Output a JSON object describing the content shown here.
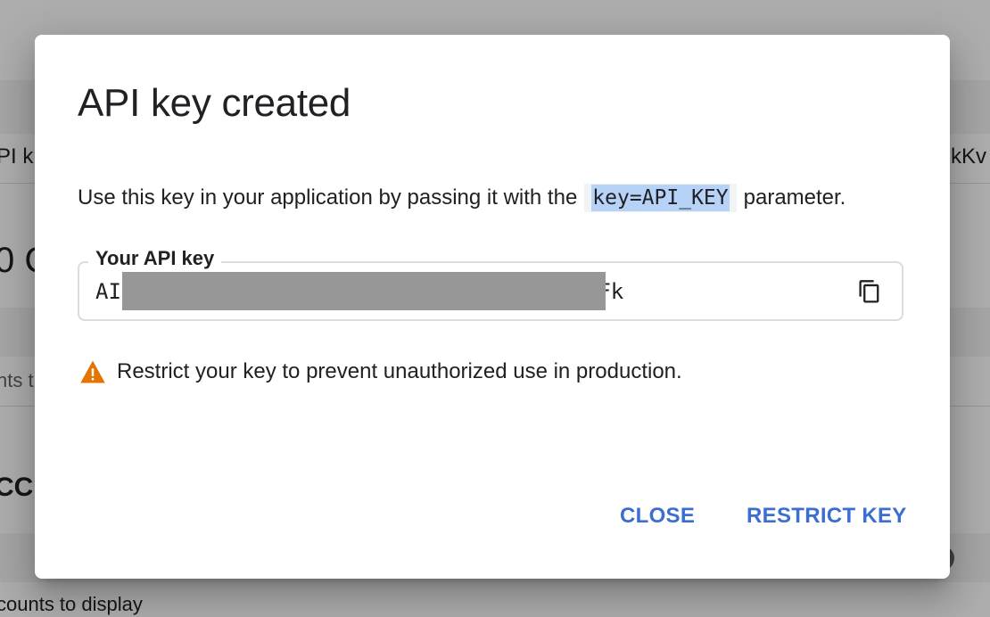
{
  "background": {
    "fragment_api_key": "PI k",
    "fragment_key_tail": "kKv",
    "fragment_big": "0 C",
    "fragment_accounts": "nts t",
    "fragment_heading": "CC",
    "fragment_no_accounts": "counts to display"
  },
  "dialog": {
    "title": "API key created",
    "description_before": "Use this key in your application by passing it with the",
    "description_code": "key=API_KEY",
    "description_after": "parameter.",
    "key_field": {
      "label": "Your API key",
      "value_prefix": "AI",
      "value_suffix": "SFk",
      "copy_icon": "copy-icon"
    },
    "warning": {
      "icon": "warning-icon",
      "text": "Restrict your key to prevent unauthorized use in production."
    },
    "actions": {
      "close_label": "CLOSE",
      "restrict_label": "RESTRICT KEY"
    }
  },
  "colors": {
    "accent": "#3c6dd1",
    "warning": "#e37400",
    "code_highlight": "#b6d2f6",
    "scrim": "rgba(0,0,0,0.32)"
  }
}
